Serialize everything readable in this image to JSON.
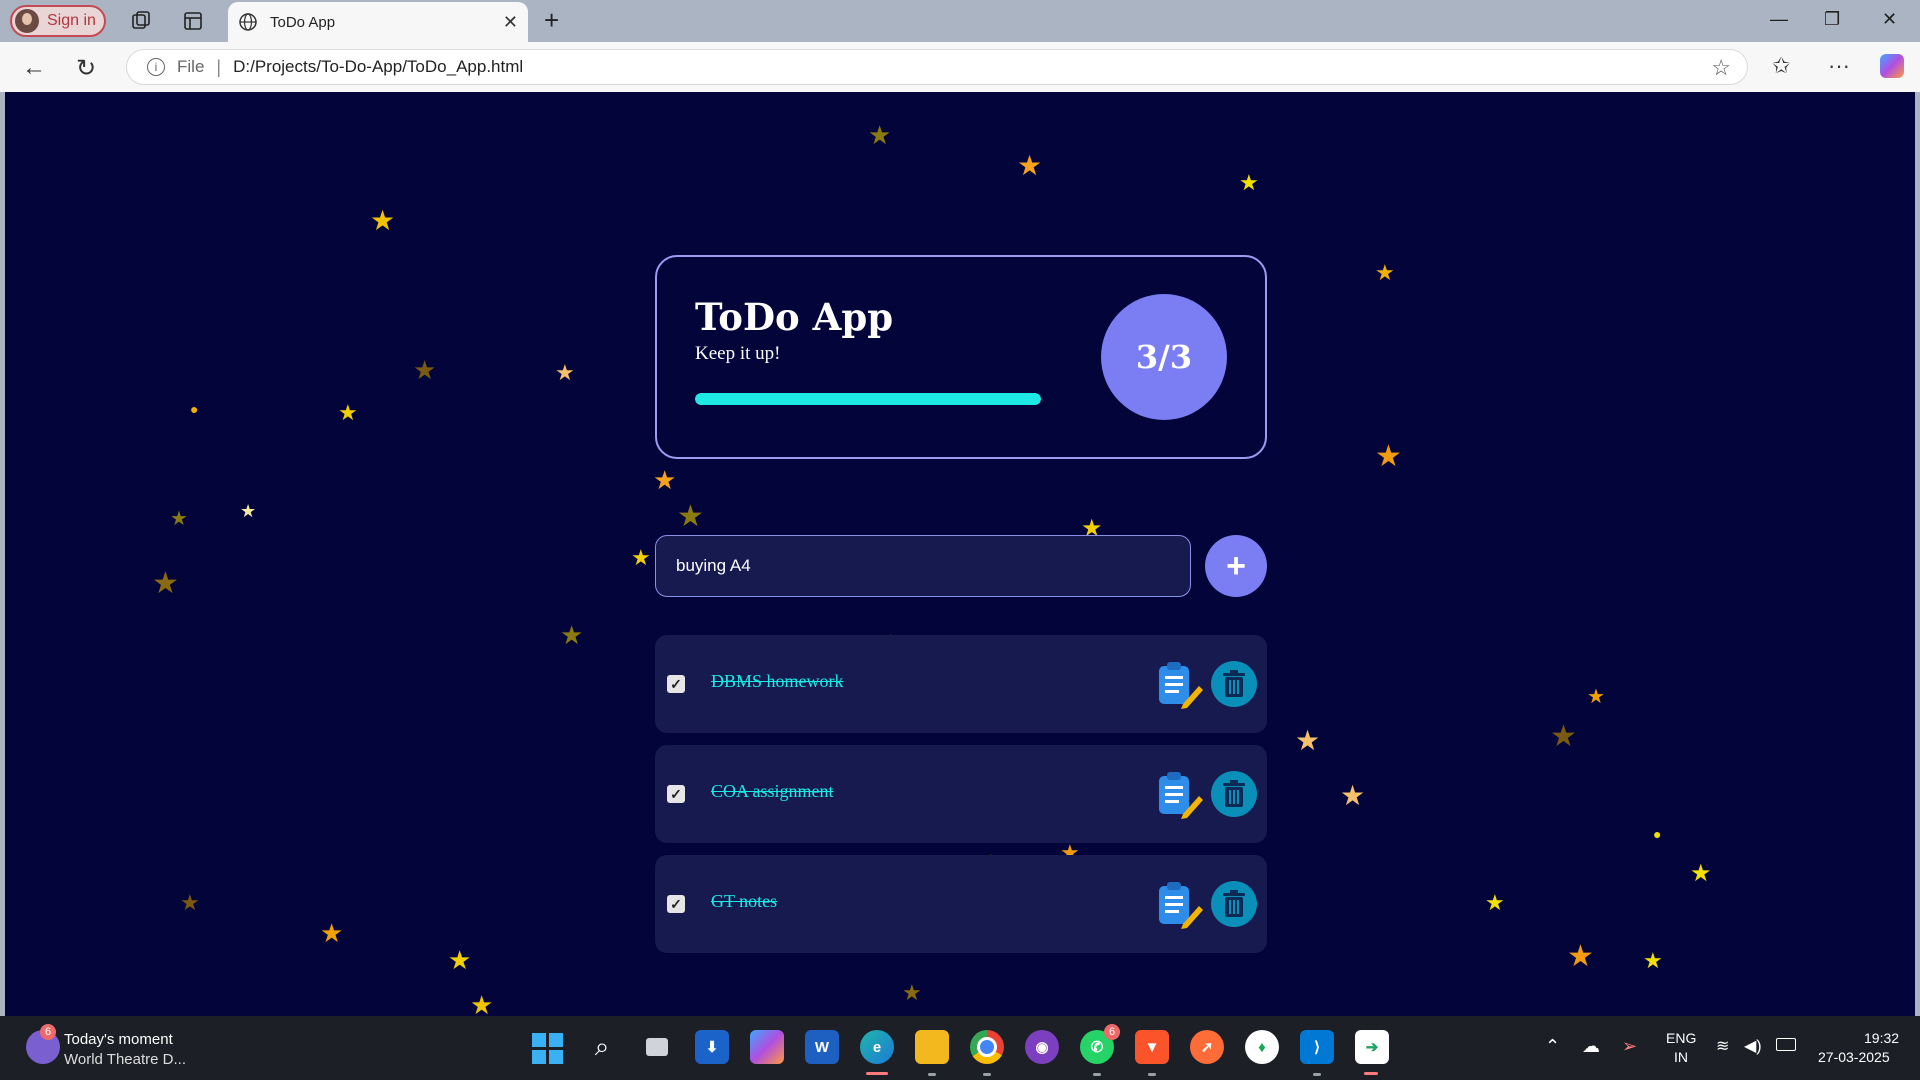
{
  "browser": {
    "profile_label": "Sign in",
    "tab_title": "ToDo App",
    "address_scheme": "File",
    "address_url": "D:/Projects/To-Do-App/ToDo_App.html"
  },
  "app": {
    "title": "ToDo App",
    "subtitle": "Keep it up!",
    "progress_fraction": 1.0,
    "progress_label": "3/3",
    "input_value": "buying A4",
    "add_label": "+"
  },
  "tasks": [
    {
      "text": "DBMS homework",
      "done": true,
      "check": "✓"
    },
    {
      "text": "COA assignment",
      "done": true,
      "check": "✓"
    },
    {
      "text": "GT notes",
      "done": true,
      "check": "✓"
    }
  ],
  "taskbar": {
    "news_title": "Today's moment",
    "news_sub": "World Theatre D...",
    "widget_badge": "6",
    "whatsapp_badge": "6",
    "language_top": "ENG",
    "language_bottom": "IN",
    "time": "19:32",
    "date": "27-03-2025"
  },
  "colors": {
    "page_bg": "#02043a",
    "accent": "#7b7ef3",
    "done_text": "#1fe9e4",
    "card_border": "#9c9cf2"
  }
}
